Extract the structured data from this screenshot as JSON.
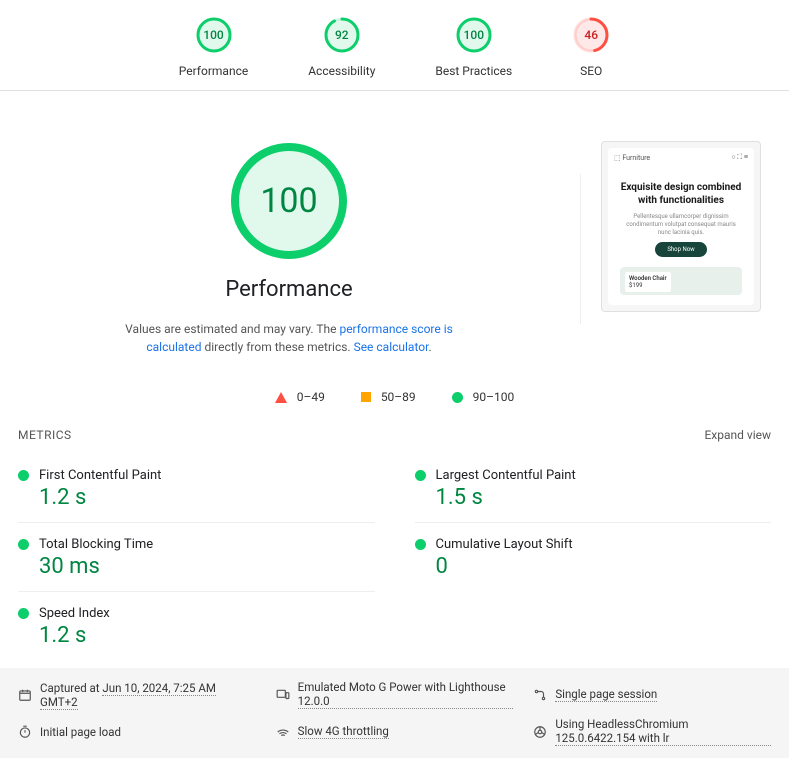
{
  "top_scores": [
    {
      "value": 100,
      "label": "Performance",
      "color": "green",
      "pct": 100
    },
    {
      "value": 92,
      "label": "Accessibility",
      "color": "green",
      "pct": 92
    },
    {
      "value": 100,
      "label": "Best Practices",
      "color": "green",
      "pct": 100
    },
    {
      "value": 46,
      "label": "SEO",
      "color": "red",
      "pct": 46
    }
  ],
  "main_gauge": {
    "value": 100,
    "title": "Performance"
  },
  "desc": {
    "pre": "Values are estimated and may vary. The ",
    "link1": "performance score is calculated",
    "mid": " directly from these metrics. ",
    "link2": "See calculator"
  },
  "legend": {
    "r0": "0–49",
    "r1": "50–89",
    "r2": "90–100"
  },
  "metrics_header": "METRICS",
  "expand_view": "Expand view",
  "metrics": [
    {
      "name": "First Contentful Paint",
      "value": "1.2 s"
    },
    {
      "name": "Largest Contentful Paint",
      "value": "1.5 s"
    },
    {
      "name": "Total Blocking Time",
      "value": "30 ms"
    },
    {
      "name": "Cumulative Layout Shift",
      "value": "0"
    },
    {
      "name": "Speed Index",
      "value": "1.2 s"
    }
  ],
  "preview": {
    "brand": "Furniture",
    "headline": "Exquisite design combined with functionalities",
    "sub": "Pellentesque ullamcorper dignissim condimentum volutpat consequat mauris nunc lacinia quis.",
    "cta": "Shop Now",
    "card_title": "Wooden Chair",
    "card_price": "$199"
  },
  "footer": {
    "captured_pre": "Captured at ",
    "captured_at": "Jun 10, 2024, 7:25 AM GMT+2",
    "emulated": "Emulated Moto G Power with Lighthouse 12.0.0",
    "session": "Single page session",
    "load": "Initial page load",
    "throttle": "Slow 4G throttling",
    "browser": "Using HeadlessChromium 125.0.6422.154 with lr"
  }
}
